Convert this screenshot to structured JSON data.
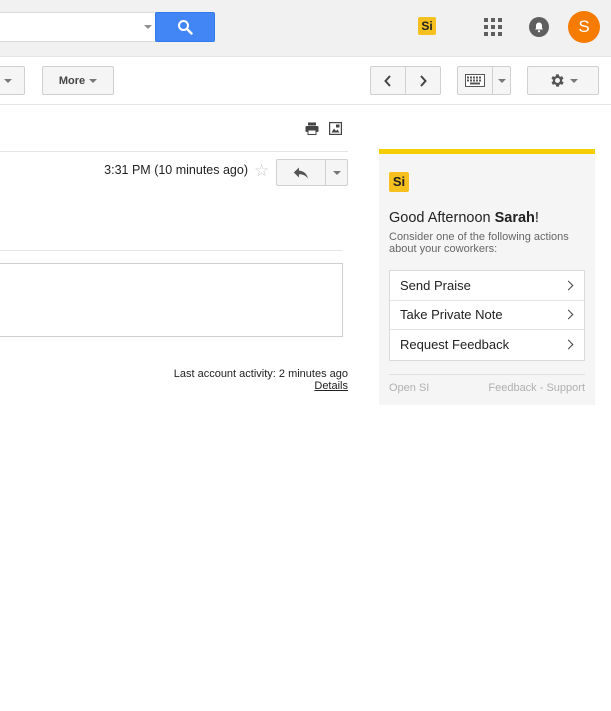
{
  "header": {
    "search": {
      "value": "",
      "placeholder": ""
    },
    "si_logo": "Si",
    "avatar_initial": "S",
    "icons": [
      "search-icon",
      "apps-icon",
      "notifications-icon"
    ]
  },
  "toolbar": {
    "more_label": "More",
    "icons": [
      "chevron-left-icon",
      "chevron-right-icon",
      "keyboard-icon",
      "gear-icon"
    ]
  },
  "message": {
    "time": "3:31 PM (10 minutes ago)",
    "icons": [
      "print-icon",
      "new-window-icon",
      "star-icon",
      "reply-icon"
    ],
    "last_activity": "Last account activity: 2 minutes ago",
    "details_link": "Details"
  },
  "si_panel": {
    "logo": "Si",
    "greeting_prefix": "Good Afternoon ",
    "greeting_name": "Sarah",
    "greeting_suffix": "!",
    "subtext": "Consider one of the following actions about your coworkers:",
    "actions": [
      {
        "label": "Send Praise"
      },
      {
        "label": "Take Private Note"
      },
      {
        "label": "Request Feedback"
      }
    ],
    "open_link": "Open SI",
    "feedback_link": "Feedback",
    "separator": " - ",
    "support_link": "Support",
    "accent_color": "#f5ce00"
  },
  "colors": {
    "search_button": "#4285f4",
    "avatar": "#f57c00",
    "si_logo": "#f6c01e"
  }
}
